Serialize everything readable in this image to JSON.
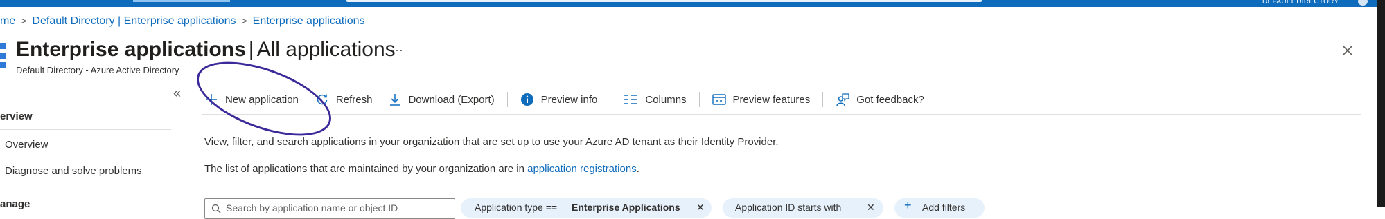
{
  "topbar": {
    "directory_label": "DEFAULT DIRECTORY"
  },
  "breadcrumb": {
    "items": [
      "me",
      "Default Directory | Enterprise applications",
      "Enterprise applications"
    ]
  },
  "header": {
    "title_bold": "Enterprise applications",
    "title_sep": "|",
    "title_rest": "All applications",
    "more": "···",
    "subtitle": "Default Directory - Azure Active Directory",
    "collapse": "«"
  },
  "sidebar": {
    "section1": "erview",
    "items": [
      "Overview",
      "Diagnose and solve problems"
    ],
    "section2": "anage"
  },
  "toolbar": {
    "new_application": "New application",
    "refresh": "Refresh",
    "download": "Download (Export)",
    "preview_info": "Preview info",
    "columns": "Columns",
    "preview_features": "Preview features",
    "got_feedback": "Got feedback?"
  },
  "content": {
    "description": "View, filter, and search applications in your organization that are set up to use your Azure AD tenant as their Identity Provider.",
    "registrations_prefix": "The list of applications that are maintained by your organization are in ",
    "registrations_link": "application registrations",
    "registrations_suffix": "."
  },
  "filters": {
    "search_placeholder": "Search by application name or object ID",
    "app_type_label": "Application type ==",
    "app_type_value": "Enterprise Applications",
    "app_id_label": "Application ID starts with",
    "add_filters": "Add filters"
  },
  "colors": {
    "accent": "#0f6cbd",
    "annotation": "#3b2a9a"
  }
}
